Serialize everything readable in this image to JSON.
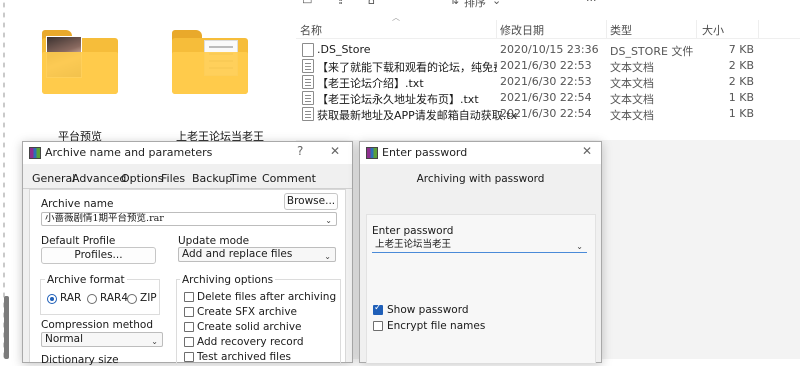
{
  "explorer_left": {
    "folders": [
      {
        "name": "平台预览",
        "icon": "photo-folder-icon"
      },
      {
        "name": "上老王论坛当老王",
        "icon": "document-folder-icon"
      }
    ]
  },
  "explorer_list": {
    "toolbar_fragment": "排序",
    "toolbar_icons": [
      "copy-icon",
      "share-icon",
      "delete-icon",
      "sort-icon",
      "chevron-down-icon",
      "more-icon"
    ],
    "columns": {
      "name": "名称",
      "date": "修改日期",
      "type": "类型",
      "size": "大小"
    },
    "files": [
      {
        "name": ".DS_Store",
        "date": "2020/10/15 23:36",
        "type": "DS_STORE 文件",
        "size": "7 KB"
      },
      {
        "name": "【来了就能下载和观看的论坛，纯免费！…",
        "date": "2021/6/30 22:53",
        "type": "文本文档",
        "size": "2 KB"
      },
      {
        "name": "【老王论坛介绍】.txt",
        "date": "2021/6/30 22:53",
        "type": "文本文档",
        "size": "2 KB"
      },
      {
        "name": "【老王论坛永久地址发布页】.txt",
        "date": "2021/6/30 22:54",
        "type": "文本文档",
        "size": "1 KB"
      },
      {
        "name": "获取最新地址及APP请发邮箱自动获取.txt",
        "date": "2021/6/30 22:54",
        "type": "文本文档",
        "size": "1 KB"
      }
    ]
  },
  "archive_dialog": {
    "title": "Archive name and parameters",
    "help": "?",
    "close": "✕",
    "tabs": [
      "General",
      "Advanced",
      "Options",
      "Files",
      "Backup",
      "Time",
      "Comment"
    ],
    "archive_name_label": "Archive name",
    "browse_label": "Browse...",
    "archive_name_value": "小蔷薇剧情1期平台预览.rar",
    "default_profile_label": "Default Profile",
    "profiles_button": "Profiles...",
    "update_mode_label": "Update mode",
    "update_mode_value": "Add and replace files",
    "archive_format_label": "Archive format",
    "formats": [
      "RAR",
      "RAR4",
      "ZIP"
    ],
    "selected_format": "RAR",
    "archiving_options_label": "Archiving options",
    "options": [
      {
        "label": "Delete files after archiving",
        "checked": false
      },
      {
        "label": "Create SFX archive",
        "checked": false
      },
      {
        "label": "Create solid archive",
        "checked": false
      },
      {
        "label": "Add recovery record",
        "checked": false
      },
      {
        "label": "Test archived files",
        "checked": false
      }
    ],
    "compression_label": "Compression method",
    "compression_value": "Normal",
    "dictionary_label": "Dictionary size"
  },
  "password_dialog": {
    "title": "Enter password",
    "close": "✕",
    "subtitle": "Archiving with password",
    "enter_password_label": "Enter password",
    "password_value": "上老王论坛当老王",
    "show_password_label": "Show password",
    "show_password_checked": true,
    "encrypt_names_label": "Encrypt file names",
    "encrypt_names_checked": false
  },
  "colors": {
    "accent": "#1f5fb8",
    "folder": "#ffcc4d",
    "strip": "#f3f3f3"
  }
}
